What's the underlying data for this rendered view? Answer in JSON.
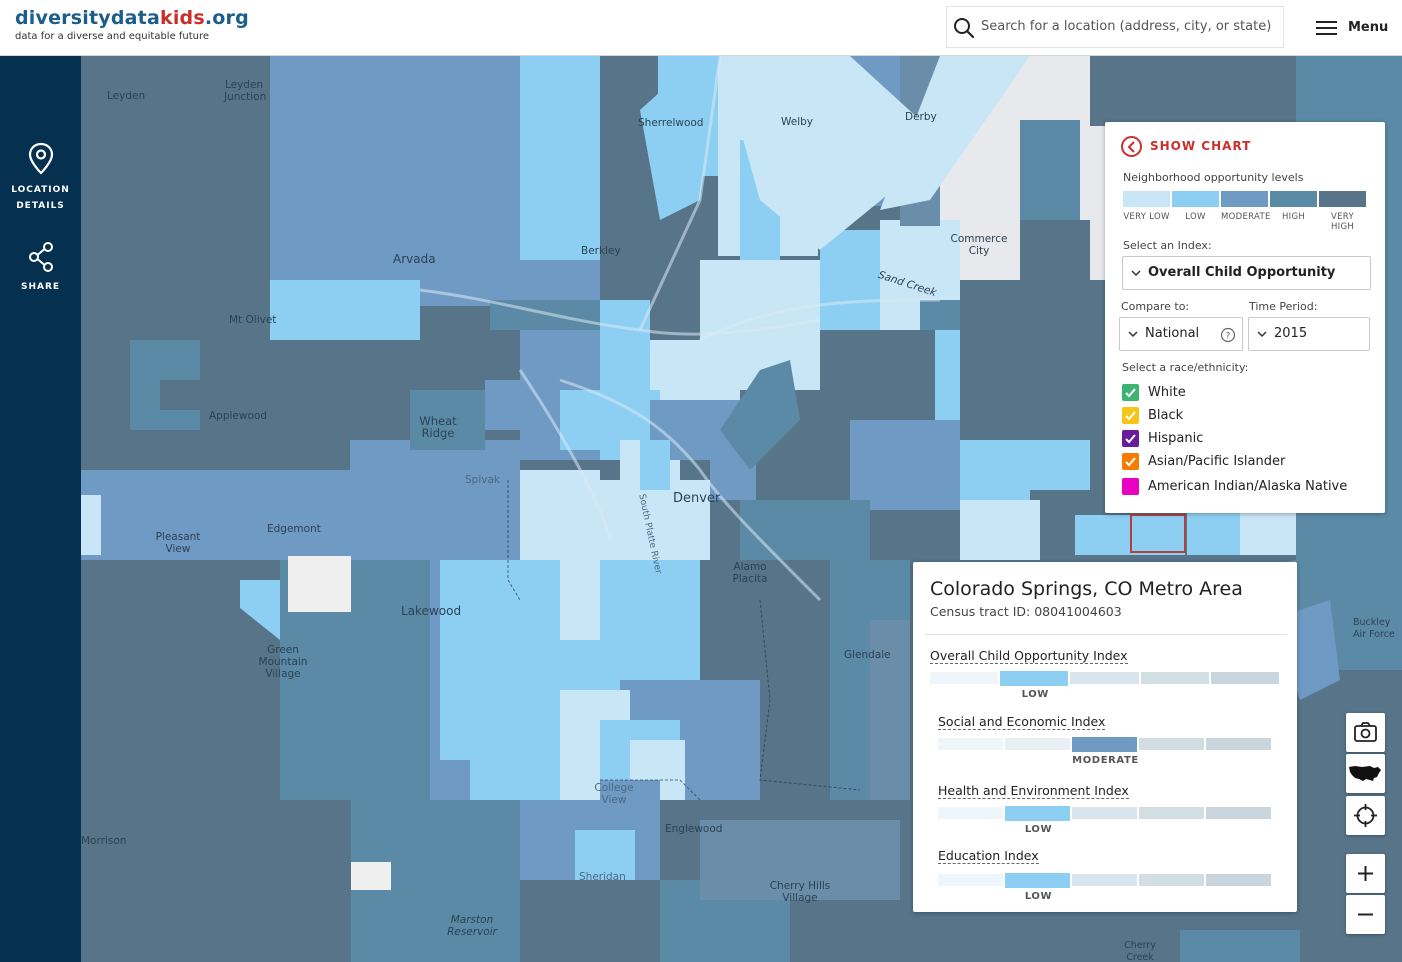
{
  "header": {
    "logo": {
      "part1": "diversity",
      "part2": "data",
      "part3": "kids",
      "part4": ".org",
      "tagline": "data for a diverse and equitable future"
    },
    "search_placeholder": "Search for a location (address, city, or state)",
    "menu_label": "Menu"
  },
  "sidebar": {
    "items": [
      {
        "line1": "LOCATION",
        "line2": "DETAILS",
        "icon": "map-pin-icon"
      },
      {
        "line1": "SHARE",
        "icon": "share-icon"
      }
    ]
  },
  "map": {
    "places": [
      "Leyden",
      "Leyden Junction",
      "Sherrelwood",
      "Welby",
      "Derby",
      "Arvada",
      "Berkley",
      "Commerce City",
      "Sand Creek",
      "Mt Olivet",
      "Applewood",
      "Wheat Ridge",
      "Spivak",
      "Denver",
      "Edgemont",
      "Pleasant View",
      "Lakewood",
      "Alamo Placita",
      "Green Mountain Village",
      "Glendale",
      "College View",
      "Englewood",
      "Sheridan",
      "Cherry Hills Village",
      "Marston Reservoir",
      "Morrison",
      "Buckley Air Force",
      "Cherry Creek",
      "South Platte River"
    ]
  },
  "panel": {
    "show_chart": "SHOW CHART",
    "legend_title": "Neighborhood opportunity levels",
    "levels": [
      {
        "label": "VERY LOW",
        "color": "#c9e6f7"
      },
      {
        "label": "LOW",
        "color": "#8dcff2"
      },
      {
        "label": "MODERATE",
        "color": "#6f9ac4"
      },
      {
        "label": "HIGH",
        "color": "#5b8aa6"
      },
      {
        "label": "VERY HIGH",
        "color": "#577489"
      }
    ],
    "index_label": "Select an Index:",
    "index_value": "Overall Child Opportunity",
    "compare_label": "Compare to:",
    "compare_value": "National",
    "period_label": "Time Period:",
    "period_value": "2015",
    "race_label": "Select a race/ethnicity:",
    "races": [
      {
        "label": "White",
        "color": "#3cb371",
        "checked": true
      },
      {
        "label": "Black",
        "color": "#f5c518",
        "checked": true
      },
      {
        "label": "Hispanic",
        "color": "#6a1b9a",
        "checked": true
      },
      {
        "label": "Asian/Pacific Islander",
        "color": "#f57c00",
        "checked": true
      },
      {
        "label": "American Indian/Alaska Native",
        "color": "#ea00c3",
        "checked": false
      }
    ]
  },
  "info": {
    "title": "Colorado Springs, CO Metro Area",
    "subtitle": "Census tract ID: 08041004603",
    "indices": [
      {
        "name": "Overall Child Opportunity Index",
        "level": "LOW",
        "level_index": 1
      },
      {
        "name": "Social and Economic Index",
        "level": "MODERATE",
        "level_index": 2
      },
      {
        "name": "Health and Environment Index",
        "level": "LOW",
        "level_index": 1
      },
      {
        "name": "Education Index",
        "level": "LOW",
        "level_index": 1
      }
    ]
  },
  "map_controls": [
    "camera-icon",
    "us-map-icon",
    "locate-icon",
    "zoom-in-icon",
    "zoom-out-icon"
  ]
}
